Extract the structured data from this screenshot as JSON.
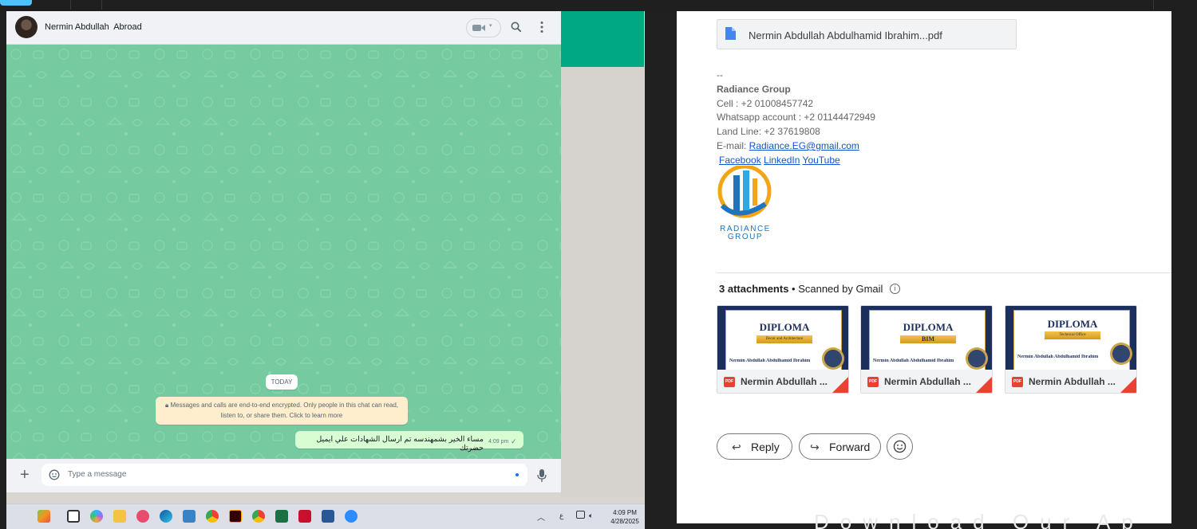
{
  "whatsapp": {
    "contact_name": "Nermin Abdullah  Abroad",
    "date_pill": "TODAY",
    "encryption_notice_line1": "Messages and calls are end-to-end encrypted. Only people in this chat can read,",
    "encryption_notice_line2": "listen to, or share them. Click to learn more",
    "message_text": "مساء الخير بشمهندسه تم ارسال الشهادات علي ايميل حضرتك",
    "message_time": "4:09 pm",
    "input_placeholder": "Type a message",
    "header_colors": {
      "accent": "#00a884",
      "chat_bg": "#75cb9f",
      "outgoing_bubble": "#d9fdd3"
    }
  },
  "taskbar": {
    "time": "4:09 PM",
    "date": "4/28/2025",
    "lang": "ع",
    "apps": [
      "widgets-icon",
      "task-view-icon",
      "copilot-icon",
      "file-explorer-icon",
      "snipping-tool-icon",
      "edge-icon",
      "notepad-icon",
      "chrome-icon",
      "illustrator-icon",
      "chrome-profile-icon",
      "excel-icon",
      "mcafee-icon",
      "word-icon",
      "zoom-icon"
    ]
  },
  "gmail": {
    "pdf_filename": "Nermin Abdullah Abdulhamid Ibrahim...pdf",
    "sig_dashes": "--",
    "company": "Radiance Group",
    "cell": "Cell : +2 01008457742",
    "whatsapp": "Whatsapp account : +2 01144472949",
    "landline": "Land Line: +2 37619808",
    "email_label": "E-mail: ",
    "email_link": "Radiance.EG@gmail.com",
    "social_links": [
      "Facebook",
      "LinkedIn",
      "YouTube"
    ],
    "logo_text_1": "RADIANCE",
    "logo_text_2": "GROUP",
    "attachments_count": "3 attachments",
    "scanned_by": " • Scanned by Gmail",
    "attachments": [
      {
        "title": "DIPLOMA",
        "ribbon": "Decor and Architecture",
        "person": "Nermin Abdullah Abdulhamid Ibrahim",
        "name": "Nermin Abdullah ..."
      },
      {
        "title": "DIPLOMA",
        "ribbon": "BIM",
        "person": "Nermin Abdullah Abdulhamid Ibrahim",
        "name": "Nermin Abdullah ..."
      },
      {
        "title": "DIPLOMA",
        "ribbon": "Technical Office",
        "person": "Nermin Abdullah Abdulhamid Ibrahim",
        "name": "Nermin Abdullah ..."
      }
    ],
    "pdf_badge": "PDF",
    "reply_label": "Reply",
    "forward_label": "Forward",
    "watermark": "Download Our Ap"
  }
}
